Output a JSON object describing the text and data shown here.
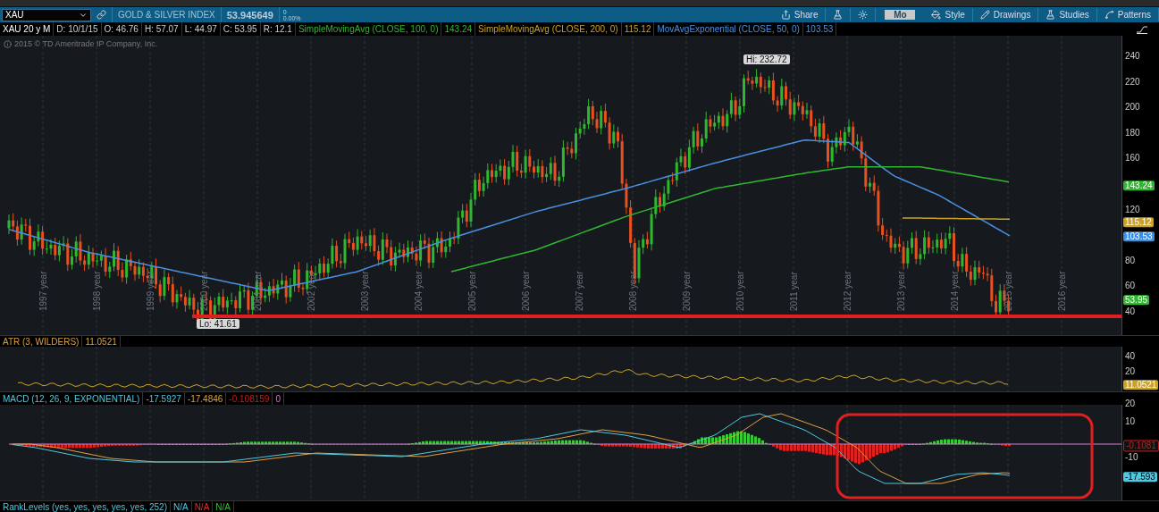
{
  "toolbar": {
    "symbol": "XAU",
    "description": "GOLD & SILVER INDEX",
    "last": "53.945649",
    "change": "0",
    "change_percent": "0.00%",
    "buttons": [
      {
        "kind": "share",
        "label": "Share"
      },
      {
        "kind": "lab"
      },
      {
        "kind": "settings"
      },
      {
        "kind": "period",
        "label": "Mo"
      },
      {
        "kind": "style",
        "label": "Style"
      },
      {
        "kind": "drawings",
        "label": "Drawings"
      },
      {
        "kind": "studies",
        "label": "Studies"
      },
      {
        "kind": "patterns",
        "label": "Patterns"
      }
    ]
  },
  "chart_header": {
    "title": "XAU 20 y M",
    "fields": [
      "D: 10/1/15",
      "O: 46.76",
      "H: 57.07",
      "L: 44.97",
      "C: 53.95",
      "R: 12.1"
    ],
    "studies": [
      {
        "label": "SimpleMovingAvg (CLOSE, 100, 0)",
        "value": "143.24"
      },
      {
        "label": "SimpleMovingAvg (CLOSE, 200, 0)",
        "value": "115.12"
      },
      {
        "label": "MovAvgExponential (CLOSE, 50, 0)",
        "value": "103.53"
      }
    ]
  },
  "copyright": "2015 © TD Ameritrade IP Company, Inc.",
  "price_chart": {
    "high_label": "Hi: 232.72",
    "low_label": "Lo: 41.61",
    "y_axis": [
      "240",
      "220",
      "200",
      "180",
      "160",
      "120",
      "80",
      "60",
      "40"
    ],
    "badges": [
      {
        "text": "143.24",
        "color": "#2fb82f"
      },
      {
        "text": "115.12",
        "color": "#c9a227"
      },
      {
        "text": "103.53",
        "color": "#3a8ee6"
      },
      {
        "text": "53.95",
        "color": "#2fb82f"
      }
    ],
    "years": [
      "1997 year",
      "1998 year",
      "1999 year",
      "2000 year",
      "2001 year",
      "2002 year",
      "2003 year",
      "2004 year",
      "2005 year",
      "2006 year",
      "2007 year",
      "2008 year",
      "2009 year",
      "2010 year",
      "2011 year",
      "2012 year",
      "2013 year",
      "2014 year",
      "2015 year",
      "2016 year"
    ]
  },
  "atr": {
    "label": "ATR (3, WILDERS)",
    "values": [
      "11.0521"
    ],
    "y_axis": [
      "40",
      "20"
    ],
    "badge": {
      "text": "11.0521",
      "color": "#c9a227"
    }
  },
  "macd": {
    "label": "MACD (12, 26, 9, EXPONENTIAL)",
    "values": [
      "-17.5927",
      "-17.4846",
      "-0.108159",
      "0"
    ],
    "y_axis": [
      "20",
      "10",
      "-10"
    ],
    "badges": [
      {
        "text": "-0.1081",
        "color": "#c02020"
      },
      {
        "text": "-17.593",
        "color": "#4fc8e0"
      }
    ]
  },
  "rank_levels": {
    "label": "RankLevels (yes, yes, yes, yes, yes, 252)",
    "values": [
      "N/A",
      "N/A",
      "N/A"
    ]
  }
}
